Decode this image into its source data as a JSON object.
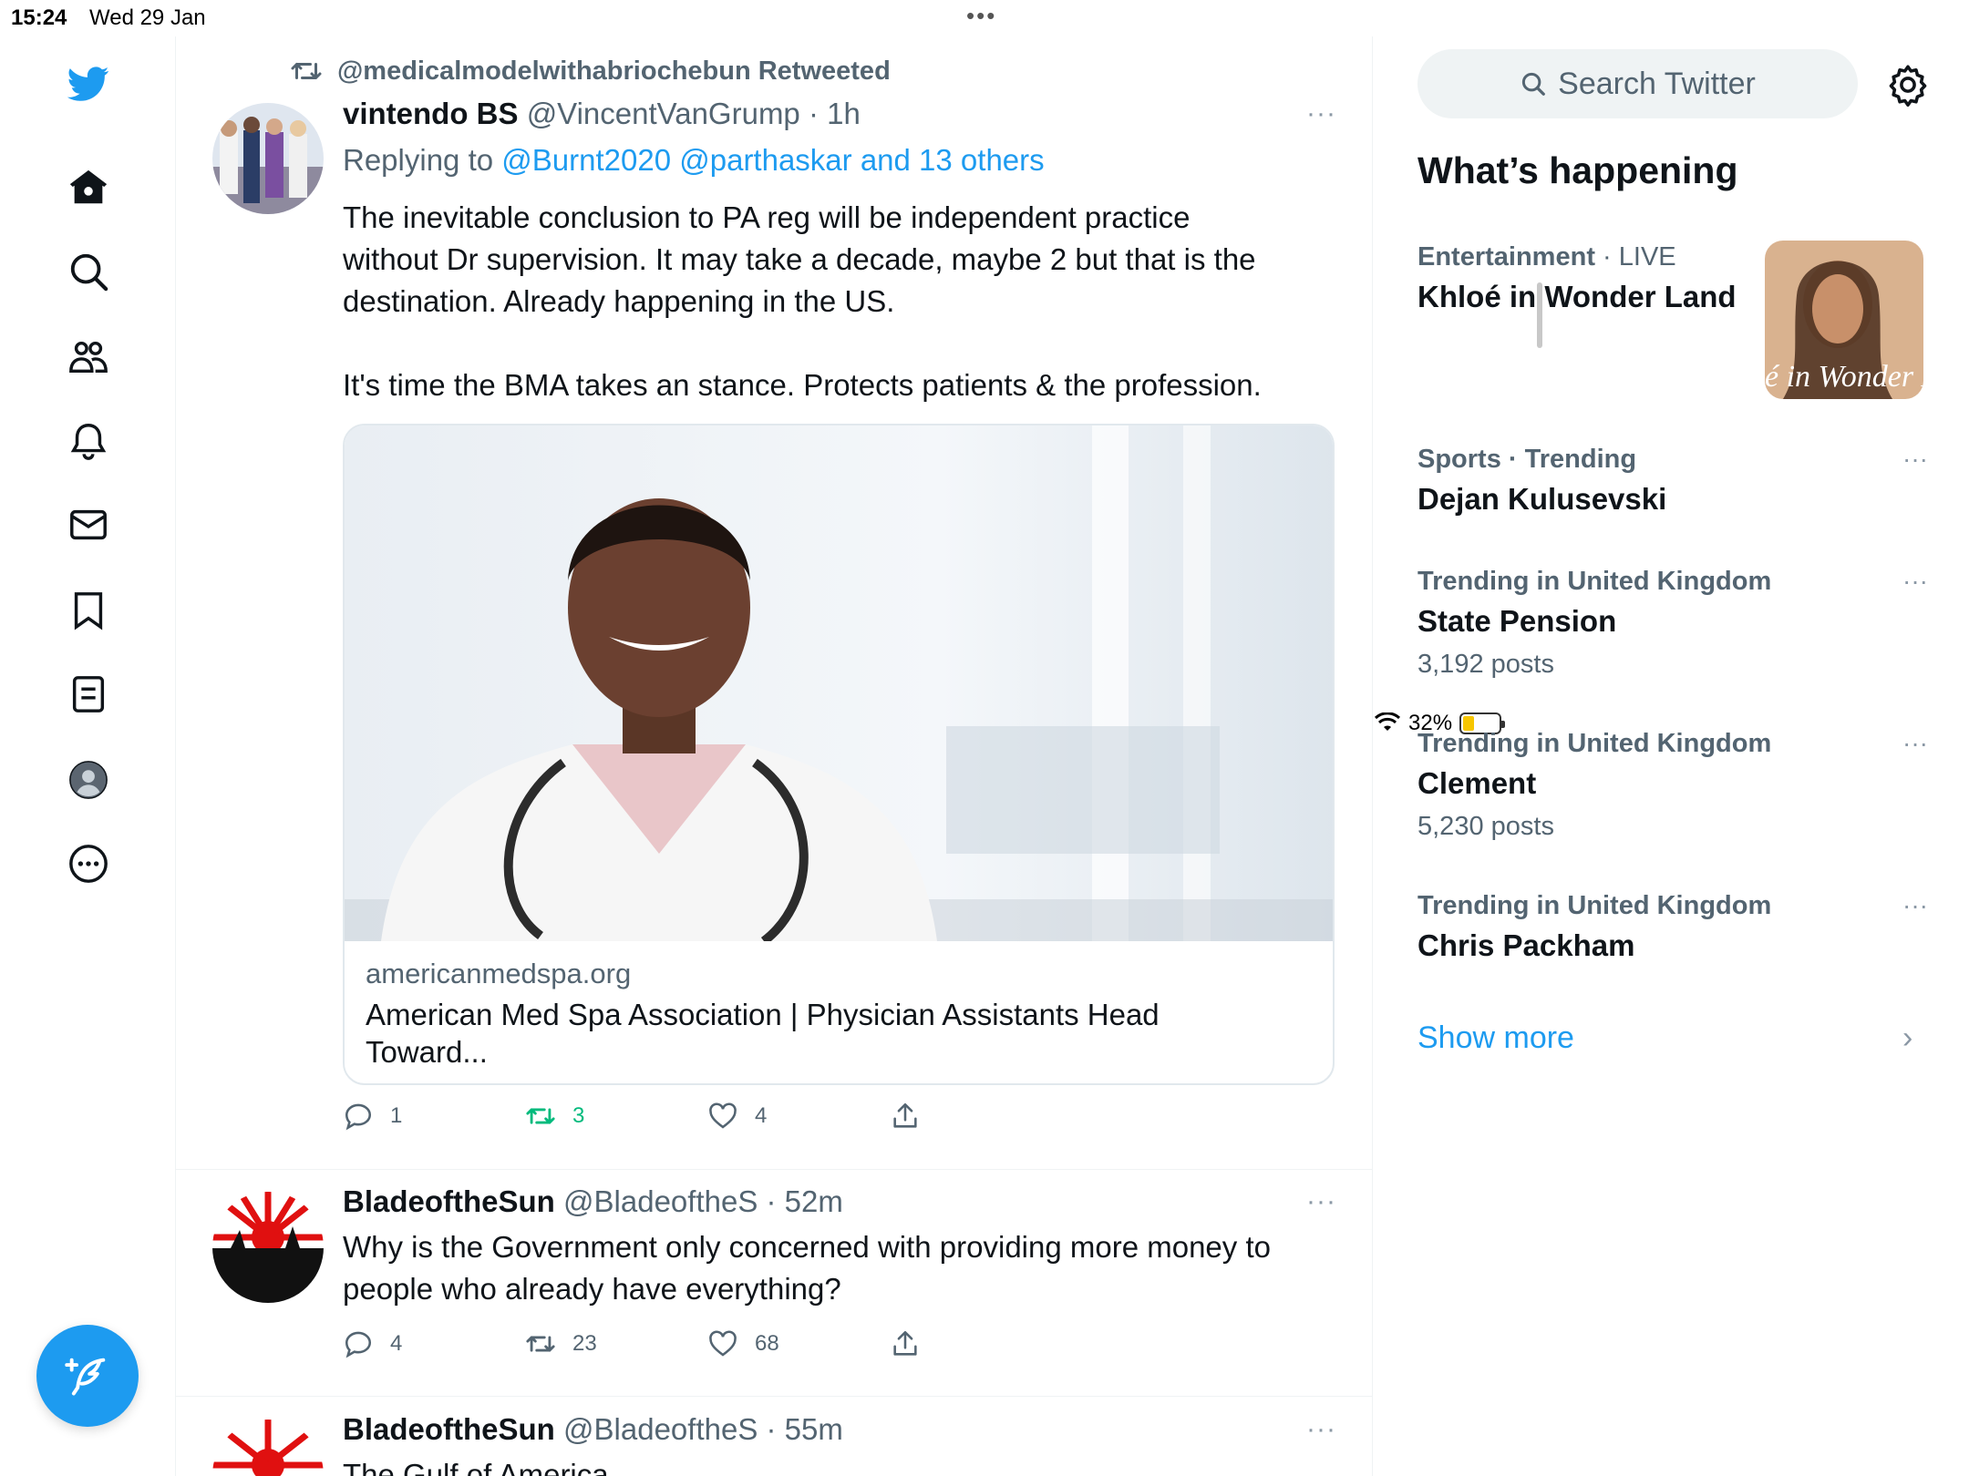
{
  "status_bar": {
    "time": "15:24",
    "date": "Wed 29 Jan",
    "battery": "32%",
    "battery_level": 0.32
  },
  "nav": {
    "items": [
      "twitter-logo",
      "home",
      "explore",
      "communities",
      "notifications",
      "messages",
      "bookmarks",
      "lists",
      "profile",
      "more"
    ]
  },
  "timeline": {
    "tweet1": {
      "retweet_label": "@medicalmodelwithabriochebun Retweeted",
      "name": "vintendo BS",
      "meta": "@VincentVanGrump · 1h",
      "more": "···",
      "replying_prefix": "Replying to",
      "replying_links": "@Burnt2020 @parthaskar and 13 others",
      "text_line1": "The inevitable conclusion to PA reg will be independent practice",
      "text_line2": "without Dr supervision. It may take a decade, maybe 2 but that is the",
      "text_line3": "destination. Already happening in the US.",
      "text_line4": "It's time the BMA takes an stance. Protects patients & the profession.",
      "card": {
        "domain": "americanmedspa.org",
        "title_line1": "American Med Spa Association | Physician Assistants Head",
        "title_line2": "Toward..."
      },
      "replies": "1",
      "retweets": "3",
      "likes": "4"
    },
    "tweet2": {
      "name": "BladeoftheSun",
      "meta": "@BladeoftheS · 52m",
      "more": "···",
      "text_line1": "Why is the Government only concerned with providing more money to",
      "text_line2": "people who already have everything?",
      "replies": "4",
      "retweets": "23",
      "likes": "68"
    },
    "tweet3": {
      "name": "BladeoftheSun",
      "meta": "@BladeoftheS · 55m",
      "more": "···",
      "text_line1": "The Gulf of America"
    }
  },
  "sidebar": {
    "search_placeholder": "Search Twitter",
    "whats_happening": "What’s happening",
    "trends": [
      {
        "category": "Entertainment",
        "tag": "· LIVE",
        "name": "Khloé in Wonder Land",
        "image_text": "é in Wonder L"
      },
      {
        "category": "Sports · Trending",
        "name": "Dejan Kulusevski",
        "more": "···"
      },
      {
        "category": "Trending in United Kingdom",
        "name": "State Pension",
        "count": "3,192 posts",
        "more": "···"
      },
      {
        "category": "Trending in United Kingdom",
        "name": "Clement",
        "count": "5,230 posts",
        "more": "···"
      },
      {
        "category": "Trending in United Kingdom",
        "name": "Chris Packham",
        "more": "···"
      }
    ],
    "show_more": "Show more",
    "chevron": "›"
  },
  "colors": {
    "accent": "#1d9bf0",
    "retweet_green": "#00ba7c",
    "secondary_text": "#536471"
  }
}
